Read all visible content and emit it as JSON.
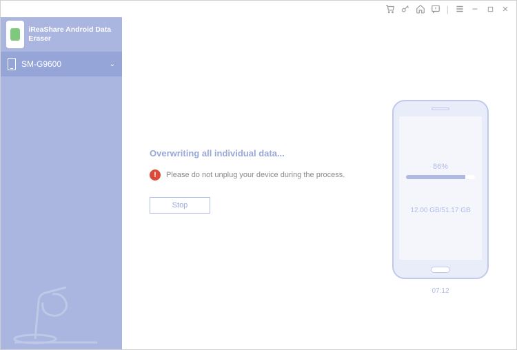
{
  "brand": {
    "name": "iReaShare Android Data Eraser"
  },
  "sidebar": {
    "device": "SM-G9600"
  },
  "status": {
    "title": "Overwriting all individual data...",
    "warning": "Please do not unplug your device during the process.",
    "stop_label": "Stop"
  },
  "progress": {
    "percent_label": "86%",
    "percent_value": 86,
    "storage": "12.00 GB/51.17 GB",
    "elapsed": "07:12"
  }
}
